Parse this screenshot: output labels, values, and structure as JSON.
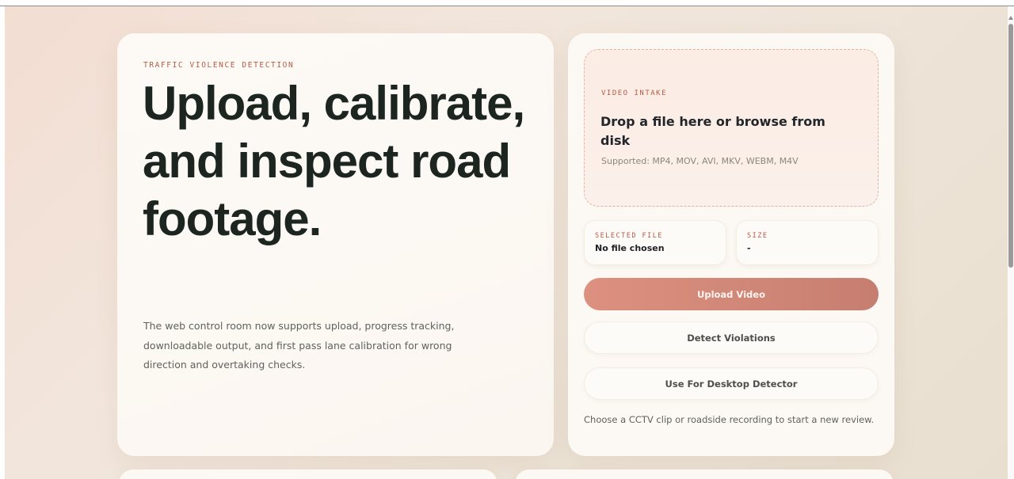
{
  "hero": {
    "eyebrow": "TRAFFIC VIOLENCE DETECTION",
    "title": "Upload, calibrate, and inspect road footage.",
    "description": "The web control room now supports upload, progress tracking, downloadable output, and first pass lane calibration for wrong direction and overtaking checks."
  },
  "intake": {
    "label": "VIDEO INTAKE",
    "title": "Drop a file here or browse from disk",
    "supported": "Supported: MP4, MOV, AVI, MKV, WEBM, M4V"
  },
  "selected_file": {
    "label": "SELECTED FILE",
    "value": "No file chosen"
  },
  "size": {
    "label": "SIZE",
    "value": "-"
  },
  "buttons": {
    "upload": "Upload Video",
    "detect": "Detect Violations",
    "desktop": "Use For Desktop Detector"
  },
  "status_text": "Choose a CCTV clip or roadside recording to start a new review."
}
